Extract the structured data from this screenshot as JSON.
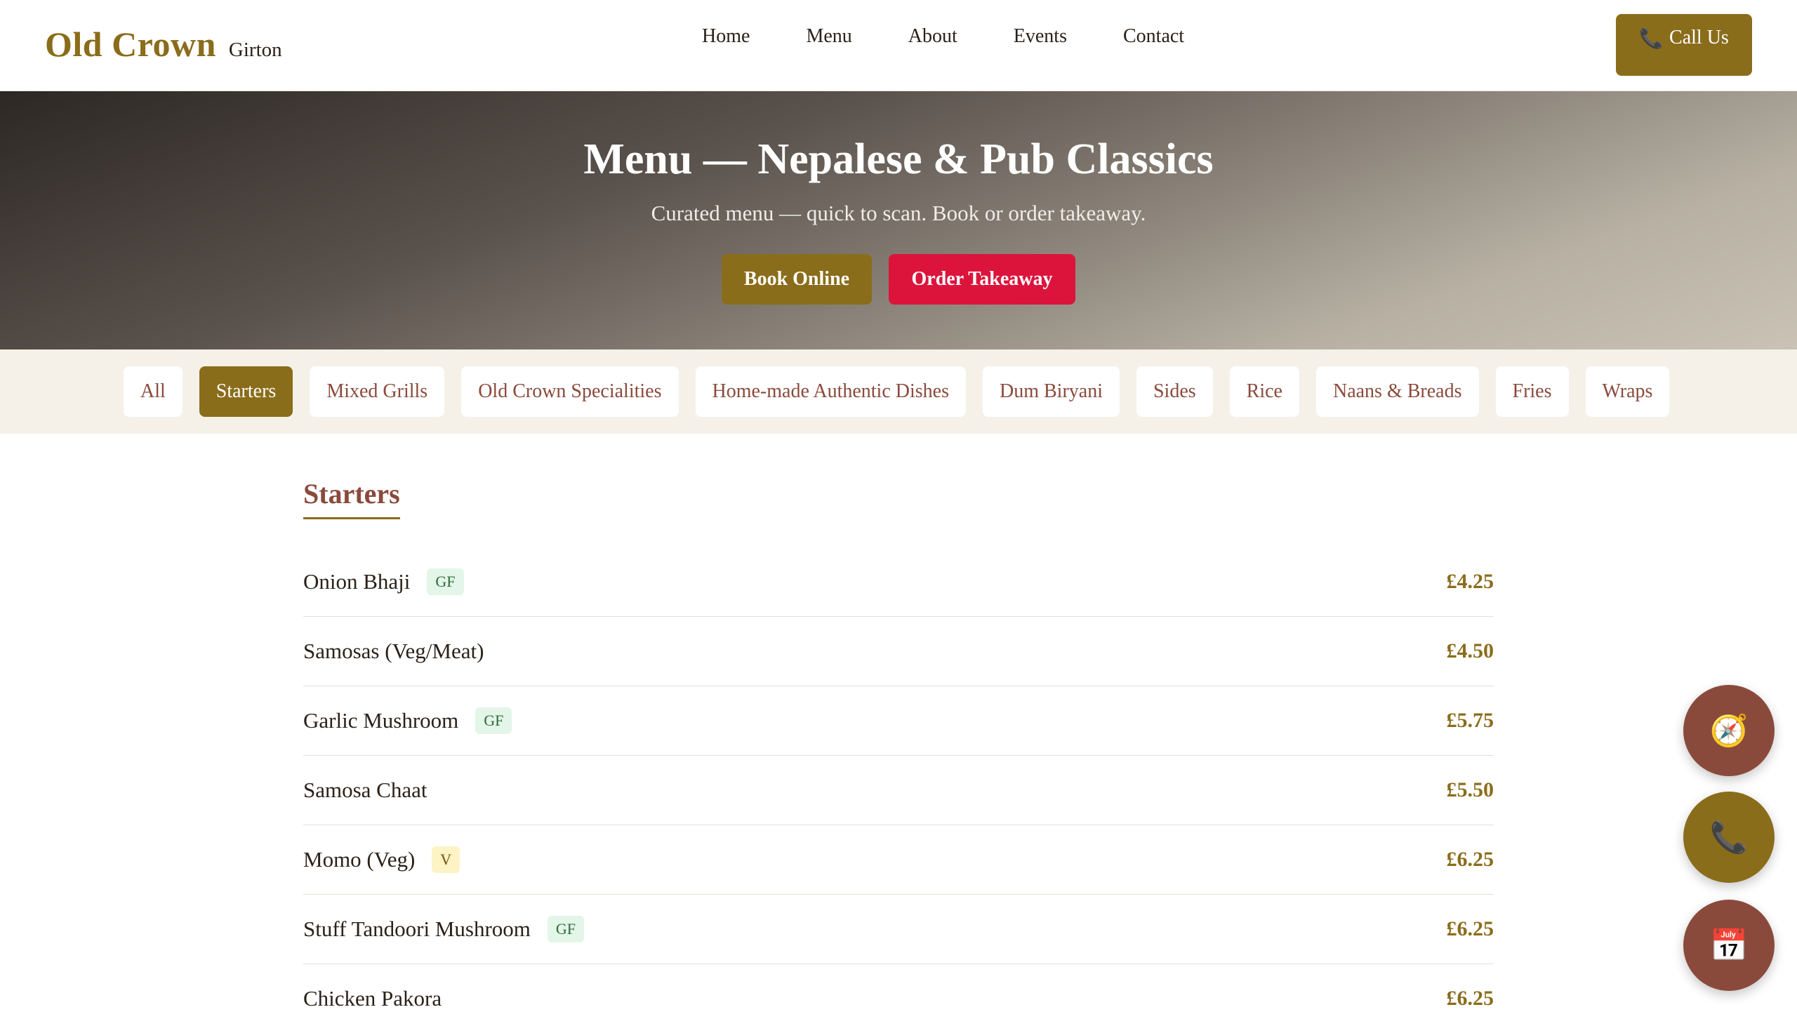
{
  "header": {
    "brand": "Old Crown",
    "location": "Girton",
    "nav": [
      "Home",
      "Menu",
      "About",
      "Events",
      "Contact"
    ],
    "call_label": "Call Us",
    "call_icon": "phone-icon"
  },
  "hero": {
    "title": "Menu — Nepalese & Pub Classics",
    "subtitle": "Curated menu — quick to scan. Book or order takeaway.",
    "book_label": "Book Online",
    "order_label": "Order Takeaway"
  },
  "categories": {
    "items": [
      "All",
      "Starters",
      "Mixed Grills",
      "Old Crown Specialities",
      "Home-made Authentic Dishes",
      "Dum Biryani",
      "Sides",
      "Rice",
      "Naans & Breads",
      "Fries",
      "Wraps"
    ],
    "active": "Starters"
  },
  "section": {
    "title": "Starters",
    "items": [
      {
        "name": "Onion Bhaji",
        "badge": "GF",
        "price": "£4.25"
      },
      {
        "name": "Samosas (Veg/Meat)",
        "badge": "",
        "price": "£4.50"
      },
      {
        "name": "Garlic Mushroom",
        "badge": "GF",
        "price": "£5.75"
      },
      {
        "name": "Samosa Chaat",
        "badge": "",
        "price": "£5.50"
      },
      {
        "name": "Momo (Veg)",
        "badge": "V",
        "price": "£6.25"
      },
      {
        "name": "Stuff Tandoori Mushroom",
        "badge": "GF",
        "price": "£6.25"
      },
      {
        "name": "Chicken Pakora",
        "badge": "",
        "price": "£6.25"
      }
    ]
  },
  "fabs": [
    "compass-icon",
    "phone-icon",
    "calendar-icon"
  ],
  "colors": {
    "gold": "#8a6d1b",
    "maroon": "#8a4a3b",
    "crimson": "#dc143c",
    "cream": "#f5f1e8"
  }
}
